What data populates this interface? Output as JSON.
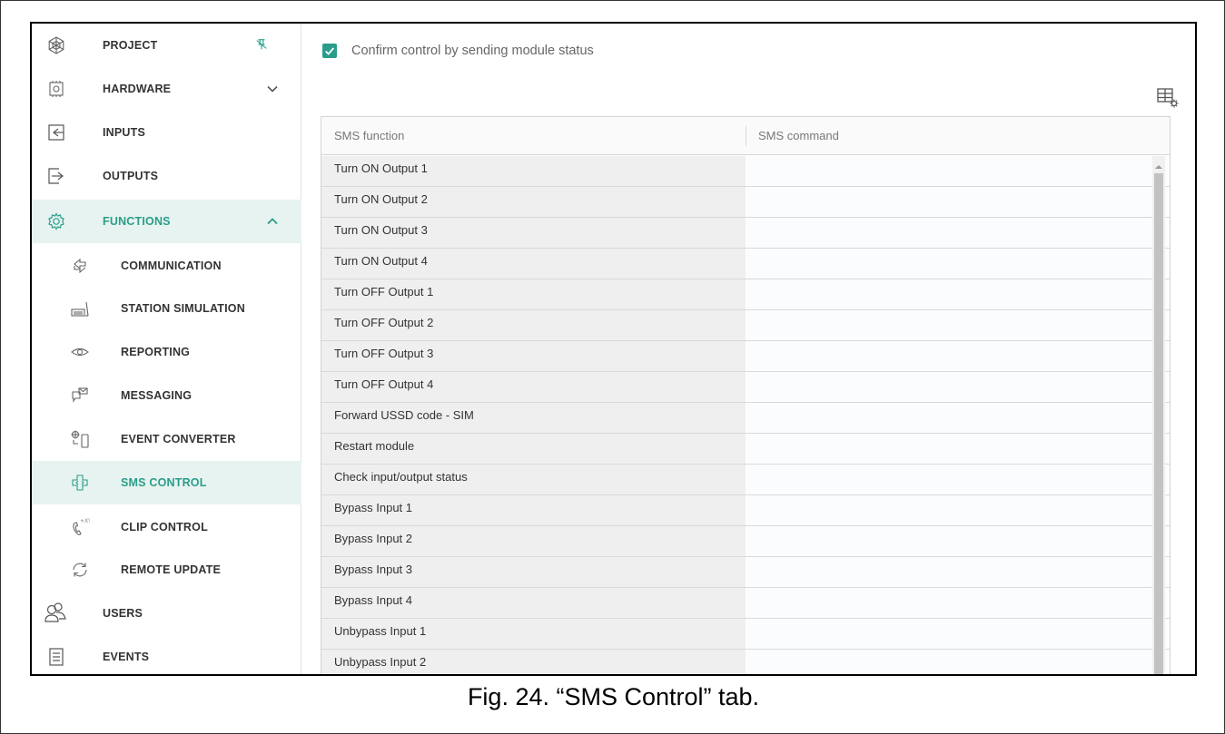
{
  "sidebar": {
    "items": [
      {
        "label": "PROJECT",
        "icon": "project-icon",
        "level": 1,
        "extra": "pin"
      },
      {
        "label": "HARDWARE",
        "icon": "hardware-icon",
        "level": 1,
        "extra": "chevron-down"
      },
      {
        "label": "INPUTS",
        "icon": "inputs-icon",
        "level": 1
      },
      {
        "label": "OUTPUTS",
        "icon": "outputs-icon",
        "level": 1
      },
      {
        "label": "FUNCTIONS",
        "icon": "functions-gear-icon",
        "level": 1,
        "extra": "chevron-up",
        "active": true
      },
      {
        "label": "COMMUNICATION",
        "icon": "communication-icon",
        "level": 2
      },
      {
        "label": "STATION SIMULATION",
        "icon": "station-simulation-icon",
        "level": 2
      },
      {
        "label": "REPORTING",
        "icon": "reporting-eye-icon",
        "level": 2
      },
      {
        "label": "MESSAGING",
        "icon": "messaging-icon",
        "level": 2
      },
      {
        "label": "EVENT CONVERTER",
        "icon": "event-converter-icon",
        "level": 2
      },
      {
        "label": "SMS CONTROL",
        "icon": "sms-control-icon",
        "level": 2,
        "active": true
      },
      {
        "label": "CLIP CONTROL",
        "icon": "clip-control-icon",
        "level": 2
      },
      {
        "label": "REMOTE UPDATE",
        "icon": "remote-update-icon",
        "level": 2
      },
      {
        "label": "USERS",
        "icon": "users-icon",
        "level": 1
      },
      {
        "label": "EVENTS",
        "icon": "events-icon",
        "level": 1
      }
    ]
  },
  "main": {
    "confirm_checkbox": {
      "label": "Confirm control by sending module status",
      "checked": true
    },
    "table": {
      "columns": [
        "SMS function",
        "SMS command"
      ],
      "rows": [
        {
          "function": "Turn ON Output 1",
          "command": ""
        },
        {
          "function": "Turn ON Output 2",
          "command": ""
        },
        {
          "function": "Turn ON Output 3",
          "command": ""
        },
        {
          "function": "Turn ON Output 4",
          "command": ""
        },
        {
          "function": "Turn OFF Output 1",
          "command": ""
        },
        {
          "function": "Turn OFF Output 2",
          "command": ""
        },
        {
          "function": "Turn OFF Output 3",
          "command": ""
        },
        {
          "function": "Turn OFF Output 4",
          "command": ""
        },
        {
          "function": "Forward USSD code - SIM",
          "command": ""
        },
        {
          "function": "Restart module",
          "command": ""
        },
        {
          "function": "Check input/output status",
          "command": ""
        },
        {
          "function": "Bypass Input 1",
          "command": ""
        },
        {
          "function": "Bypass Input 2",
          "command": ""
        },
        {
          "function": "Bypass Input 3",
          "command": ""
        },
        {
          "function": "Bypass Input 4",
          "command": ""
        },
        {
          "function": "Unbypass Input 1",
          "command": ""
        },
        {
          "function": "Unbypass Input 2",
          "command": ""
        }
      ]
    }
  },
  "caption": "Fig. 24. “SMS Control” tab.",
  "colors": {
    "accent": "#2a9d8a",
    "active_bg": "#e7f3f0"
  }
}
